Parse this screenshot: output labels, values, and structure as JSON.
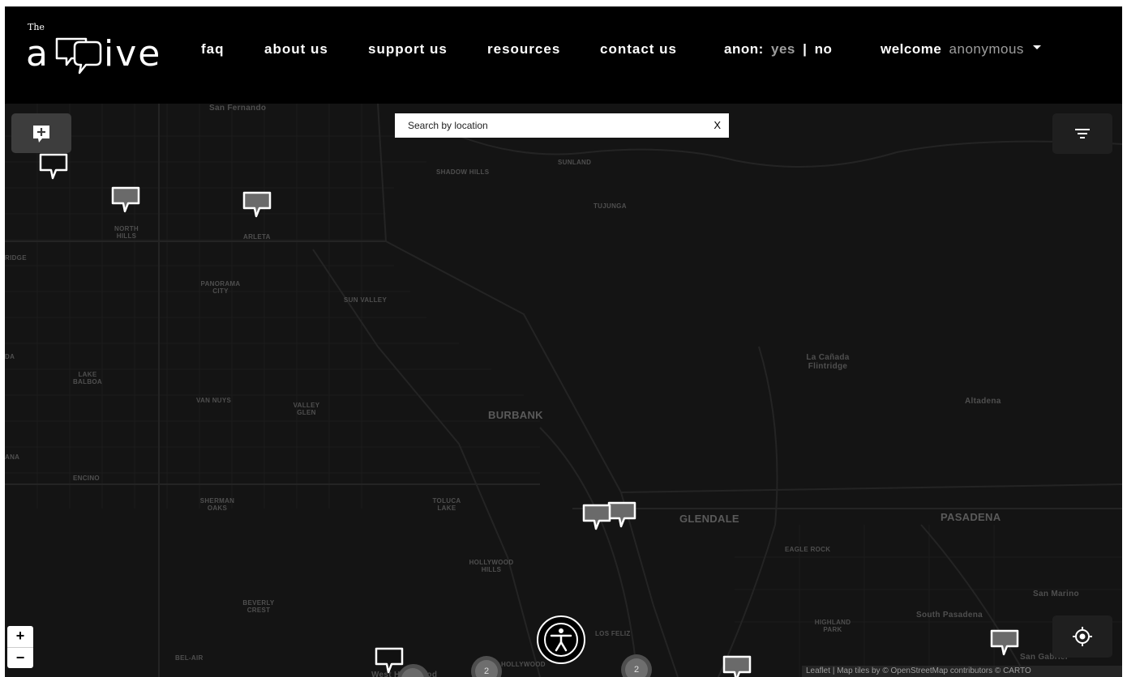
{
  "logo": {
    "small_text": "The",
    "icon": "speech-bubbles-logo-icon",
    "letter_a": "a",
    "letters_ive": "ive"
  },
  "nav": {
    "links": [
      "faq",
      "about us",
      "support us",
      "resources",
      "contact us"
    ],
    "anon_label": "anon:",
    "anon_yes": "yes",
    "anon_sep": "|",
    "anon_no": "no",
    "welcome_label": "welcome",
    "welcome_user": "anonymous"
  },
  "map": {
    "search_placeholder": "Search by location",
    "search_value": "",
    "search_clear": "X",
    "zoom_in": "+",
    "zoom_out": "−",
    "places": [
      "San Fernando",
      "SHADOW HILLS",
      "SUNLAND",
      "TUJUNGA",
      "NORTH HILLS",
      "ARLETA",
      "RIDGE",
      "PANORAMA CITY",
      "SUN VALLEY",
      "LAKE BALBOA",
      "VAN NUYS",
      "VALLEY GLEN",
      "BURBANK",
      "La Cañada Flintridge",
      "Altadena",
      "ENCINO",
      "SHERMAN OAKS",
      "TOLUCA LAKE",
      "GLENDALE",
      "PASADENA",
      "EAGLE ROCK",
      "HOLLYWOOD HILLS",
      "BEVERLY CREST",
      "LOS FELIZ",
      "HIGHLAND PARK",
      "South Pasadena",
      "San Marino",
      "BEL-AIR",
      "HOLLYWOOD",
      "San Gabriel",
      "West Hollywood",
      "DA",
      "ANA"
    ],
    "clusters": [
      "2",
      "2"
    ],
    "attribution": {
      "leaflet": "Leaflet",
      "sep": "|",
      "prefix": "Map tiles by ©",
      "osm": "OpenStreetMap",
      "contributors": "contributors ©",
      "carto": "CARTO"
    }
  },
  "colors": {
    "nav_bg": "#000000",
    "map_bg": "#141414",
    "muted": "#9e9e9e",
    "marker": "#6a6a6a"
  }
}
